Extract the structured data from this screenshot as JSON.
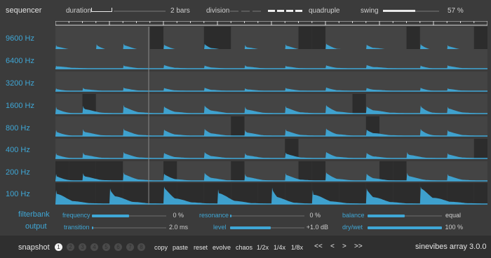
{
  "sequencer": {
    "title": "sequencer",
    "duration_label": "duration",
    "duration_value": "2 bars",
    "division_label": "division",
    "division_value": "quadruple",
    "swing_label": "swing",
    "swing_value": "57 %",
    "swing_level": 0.57
  },
  "bands": [
    "9600 Hz",
    "6400 Hz",
    "3200 Hz",
    "1600 Hz",
    "800 Hz",
    "400 Hz",
    "200 Hz",
    "100 Hz"
  ],
  "filterbank": {
    "title": "filterbank",
    "frequency_label": "frequency",
    "frequency_value": "0 %",
    "frequency_level": 0.5,
    "resonance_label": "resonance",
    "resonance_value": "0 %",
    "resonance_level": 0.0,
    "balance_label": "balance",
    "balance_value": "equal",
    "balance_level": 0.5
  },
  "output": {
    "title": "output",
    "transition_label": "transition",
    "transition_value": "2.0 ms",
    "transition_level": 0.0,
    "level_label": "level",
    "level_value": "+1.0 dB",
    "level_level": 0.55,
    "drywet_label": "dry/wet",
    "drywet_value": "100 %",
    "drywet_level": 1.0
  },
  "bottom": {
    "snapshot_label": "snapshot",
    "snapshots": [
      "1",
      "2",
      "3",
      "4",
      "5",
      "6",
      "7",
      "8"
    ],
    "active_snapshot": "1",
    "actions": [
      "copy",
      "paste",
      "reset",
      "evolve",
      "chaos",
      "1/2x",
      "1/4x",
      "1/8x"
    ],
    "nav": [
      "<<",
      "<",
      ">",
      ">>"
    ],
    "product": "sinevibes array 3.0.0"
  },
  "colors": {
    "accent": "#3fa7d6",
    "background": "#3b3b3b",
    "lane": "#444444",
    "dark_step": "#2c2c2c"
  }
}
